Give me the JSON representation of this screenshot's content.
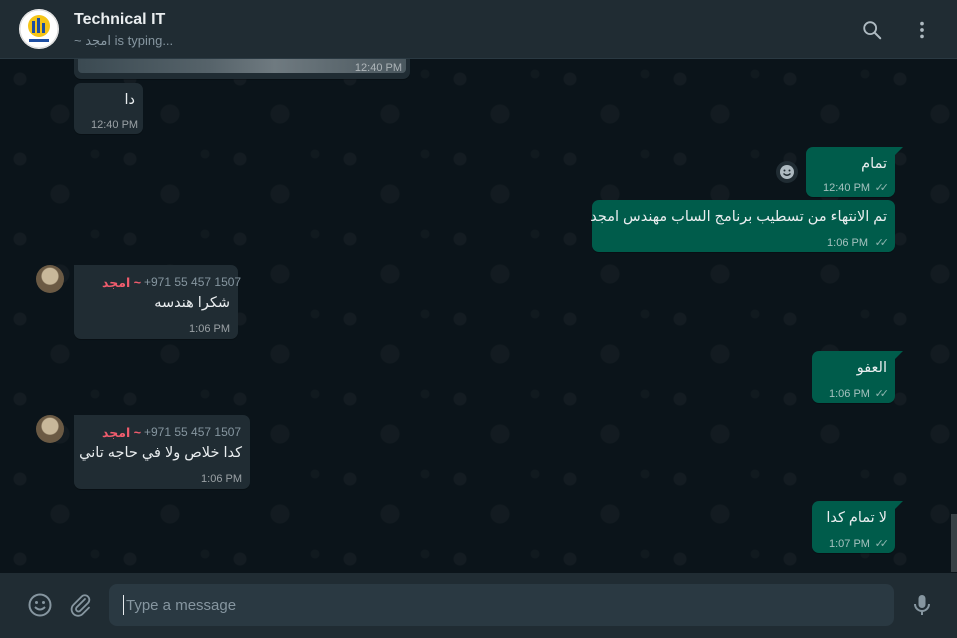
{
  "header": {
    "title": "Technical IT",
    "subtitle": "~ امجد is typing...",
    "avatar_logo_text": "LOGO"
  },
  "messages": [
    {
      "type": "in-media",
      "time": "12:40 PM"
    },
    {
      "type": "in",
      "text": "دا",
      "time": "12:40 PM"
    },
    {
      "type": "out",
      "text": "تمام",
      "time": "12:40 PM"
    },
    {
      "type": "out",
      "text": "تم الانتهاء من تسطيب برنامج الساب مهندس امجد",
      "time": "1:06 PM"
    },
    {
      "type": "in",
      "sender": "~ امجد",
      "phone": "+971 55 457 1507",
      "text": "شكرا هندسه",
      "time": "1:06 PM"
    },
    {
      "type": "out",
      "text": "العفو",
      "time": "1:06 PM"
    },
    {
      "type": "in",
      "sender": "~ امجد",
      "phone": "+971 55 457 1507",
      "text": "كدا خلاص ولا في حاجه تاني",
      "time": "1:06 PM"
    },
    {
      "type": "out",
      "text": "لا تمام كدا",
      "time": "1:07 PM"
    }
  ],
  "footer": {
    "placeholder": "Type a message"
  },
  "colors": {
    "header_bg": "#202c33",
    "chat_bg": "#0b141a",
    "incoming_bubble": "#202c33",
    "outgoing_bubble": "#005c4b",
    "sender_name": "#f15c6d"
  },
  "icons": [
    "search-icon",
    "menu-dots-icon",
    "emoji-icon",
    "attach-icon",
    "mic-icon",
    "double-check-icon",
    "smiley-react-icon"
  ]
}
